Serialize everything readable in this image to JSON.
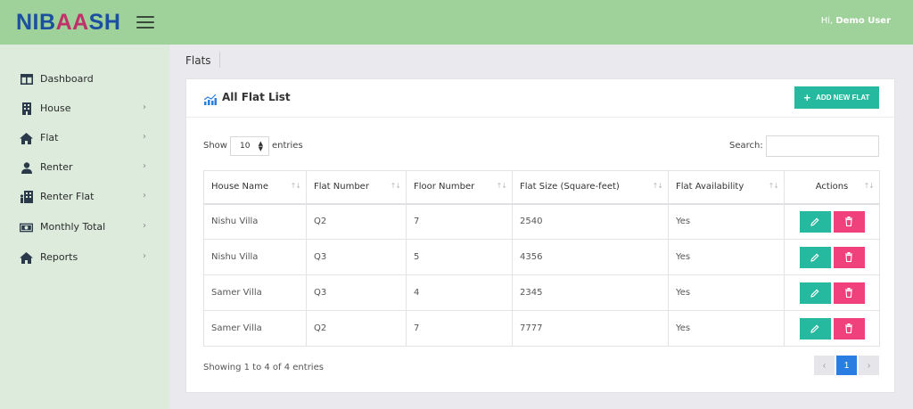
{
  "brand": {
    "prefix": "NIB",
    "accent": "AA",
    "suffix": "SH"
  },
  "user": {
    "greeting": "Hi,",
    "name": "Demo User"
  },
  "sidebar": {
    "items": [
      {
        "label": "Dashboard",
        "icon": "dashboard-icon"
      },
      {
        "label": "House",
        "icon": "building-icon"
      },
      {
        "label": "Flat",
        "icon": "home-icon"
      },
      {
        "label": "Renter",
        "icon": "user-icon"
      },
      {
        "label": "Renter Flat",
        "icon": "renter-flat-icon"
      },
      {
        "label": "Monthly Total",
        "icon": "money-icon"
      },
      {
        "label": "Reports",
        "icon": "home-icon"
      }
    ]
  },
  "page": {
    "title": "Flats"
  },
  "card": {
    "title": "All Flat List",
    "add_label": "ADD NEW FLAT"
  },
  "controls": {
    "show_label": "Show",
    "page_size": "10",
    "entries_label": "entries",
    "search_label": "Search:",
    "search_value": ""
  },
  "table": {
    "headers": [
      "House Name",
      "Flat Number",
      "Floor Number",
      "Flat Size (Square-feet)",
      "Flat Availability",
      "Actions"
    ],
    "rows": [
      [
        "Nishu Villa",
        "Q2",
        "7",
        "2540",
        "Yes"
      ],
      [
        "Nishu Villa",
        "Q3",
        "5",
        "4356",
        "Yes"
      ],
      [
        "Samer Villa",
        "Q3",
        "4",
        "2345",
        "Yes"
      ],
      [
        "Samer Villa",
        "Q2",
        "7",
        "7777",
        "Yes"
      ]
    ]
  },
  "footer": {
    "info": "Showing 1 to 4 of 4 entries",
    "prev": "‹",
    "current_page": "1",
    "next": "›"
  },
  "colors": {
    "topbar": "#9fd29a",
    "sidebar": "#dcebdb",
    "teal": "#25b99f",
    "pink": "#f0417c",
    "blue": "#2a7de1"
  }
}
